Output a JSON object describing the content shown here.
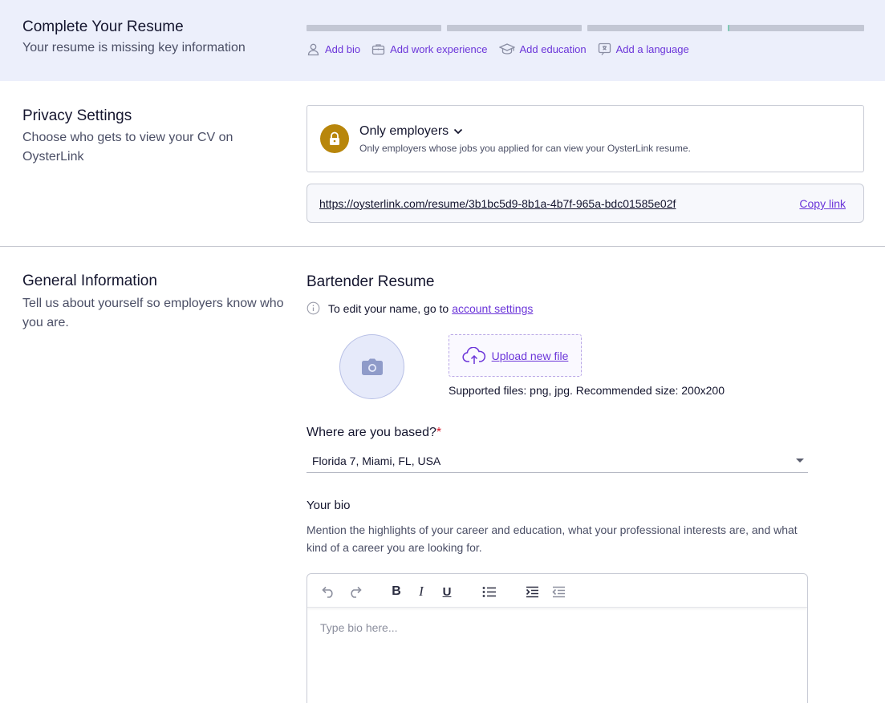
{
  "banner": {
    "title": "Complete Your Resume",
    "subtitle": "Your resume is missing key information",
    "progress_filled": 0,
    "steps": [
      {
        "label": "Add bio",
        "icon": "user-icon"
      },
      {
        "label": "Add work experience",
        "icon": "briefcase-icon"
      },
      {
        "label": "Add education",
        "icon": "graduation-cap-icon"
      },
      {
        "label": "Add a language",
        "icon": "language-icon"
      }
    ]
  },
  "privacy": {
    "title": "Privacy Settings",
    "description": "Choose who gets to view your CV on OysterLink",
    "option_title": "Only employers",
    "option_desc": "Only employers whose jobs you applied for can view your OysterLink resume.",
    "link_url": "https://oysterlink.com/resume/3b1bc5d9-8b1a-4b7f-965a-bdc01585e02f",
    "copy_label": "Copy link"
  },
  "general": {
    "title": "General Information",
    "description": "Tell us about yourself so employers know who you are.",
    "resume_title": "Bartender Resume",
    "edit_note": "To edit your name, go to",
    "edit_link": "account settings",
    "upload_label": "Upload new file",
    "supported": "Supported files: png, jpg. Recommended size: 200x200",
    "based_label": "Where are you based?",
    "based_required": "*",
    "location": "Florida 7, Miami, FL, USA",
    "bio_label": "Your bio",
    "bio_hint": "Mention the highlights of your career and education, what your professional interests are, and what kind of a career you are looking for.",
    "bio_placeholder": "Type bio here...",
    "toolbar": {
      "bold": "B",
      "italic": "I",
      "underline": "U"
    }
  },
  "colors": {
    "accent": "#6b35d9",
    "lock": "#b8860b",
    "banner_bg": "#eceffb"
  }
}
